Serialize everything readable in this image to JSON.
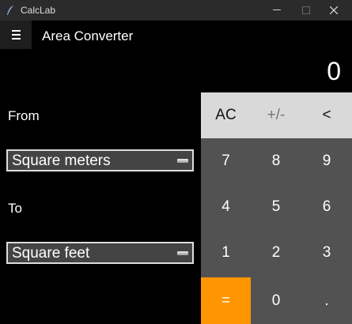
{
  "window": {
    "title": "CalcLab"
  },
  "header": {
    "title": "Area Converter"
  },
  "display": {
    "value": "0"
  },
  "converter": {
    "from_label": "From",
    "from_unit": "Square meters",
    "to_label": "To",
    "to_unit": "Square feet"
  },
  "keypad": {
    "ac": "AC",
    "sign": "+/-",
    "back": "<",
    "k7": "7",
    "k8": "8",
    "k9": "9",
    "k4": "4",
    "k5": "5",
    "k6": "6",
    "k1": "1",
    "k2": "2",
    "k3": "3",
    "equals": "=",
    "k0": "0",
    "dot": "."
  },
  "colors": {
    "accent": "#ff9500",
    "keypad": "#525252",
    "function_keys": "#d9d9d9"
  }
}
